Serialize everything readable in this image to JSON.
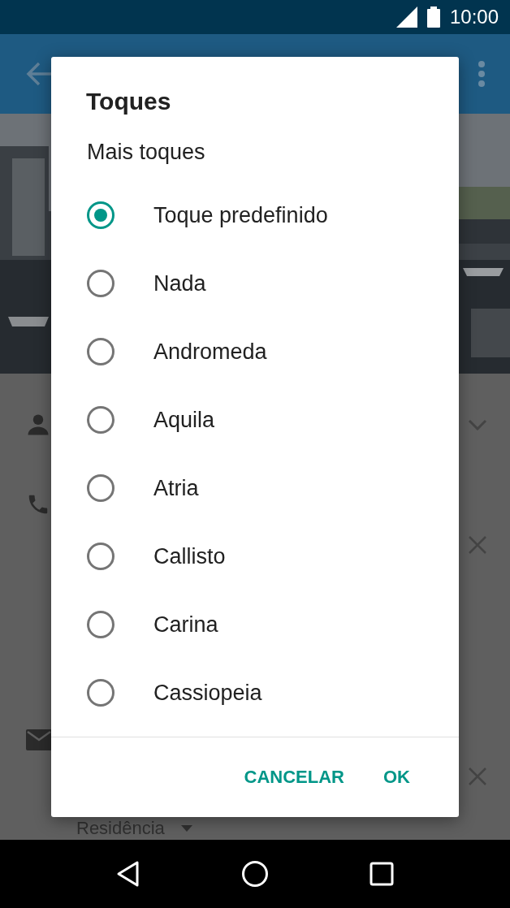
{
  "status_bar": {
    "time": "10:00"
  },
  "form": {
    "address_type": {
      "value": "Residência"
    }
  },
  "dialog": {
    "title": "Toques",
    "section": "Mais toques",
    "options": [
      {
        "label": "Toque predefinido",
        "selected": true
      },
      {
        "label": "Nada",
        "selected": false
      },
      {
        "label": "Andromeda",
        "selected": false
      },
      {
        "label": "Aquila",
        "selected": false
      },
      {
        "label": "Atria",
        "selected": false
      },
      {
        "label": "Callisto",
        "selected": false
      },
      {
        "label": "Carina",
        "selected": false
      },
      {
        "label": "Cassiopeia",
        "selected": false
      }
    ],
    "buttons": [
      "CANCELAR",
      "OK"
    ]
  }
}
